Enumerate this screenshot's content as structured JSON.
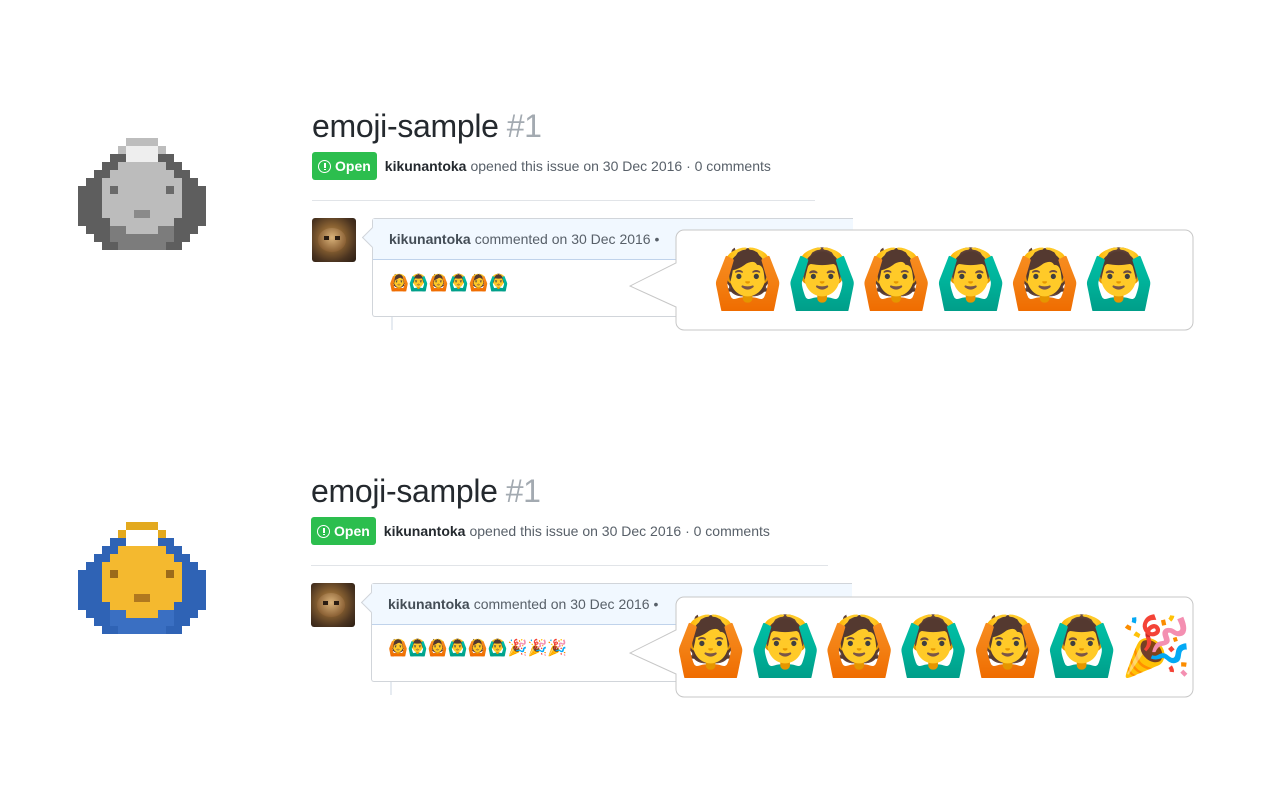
{
  "panels": [
    {
      "issue": {
        "repo": "emoji-sample",
        "number": "#1",
        "state": "Open",
        "author": "kikunantoka",
        "opened_text": "opened this issue on 30 Dec 2016 · 0 comments"
      },
      "comment": {
        "author": "kikunantoka",
        "header_text": "commented on 30 Dec 2016 •",
        "body": "🙆🙆‍♂️🙆🙆‍♂️🙆🙆‍♂️"
      },
      "bubble_text": "🙆🙆‍♂️🙆🙆‍♂️🙆🙆‍♂️"
    },
    {
      "issue": {
        "repo": "emoji-sample",
        "number": "#1",
        "state": "Open",
        "author": "kikunantoka",
        "opened_text": "opened this issue on 30 Dec 2016 · 0 comments"
      },
      "comment": {
        "author": "kikunantoka",
        "header_text": "commented on 30 Dec 2016 •",
        "body": "🙆🙆‍♂️🙆🙆‍♂️🙆🙆‍♂️🎉🎉🎉"
      },
      "bubble_text": "🙆🙆‍♂️🙆🙆‍♂️🙆🙆‍♂️🎉"
    }
  ],
  "pixel_icons": [
    {
      "name": "grayscale-emoji-icon",
      "palette": "gray"
    },
    {
      "name": "color-emoji-icon",
      "palette": "color"
    }
  ]
}
